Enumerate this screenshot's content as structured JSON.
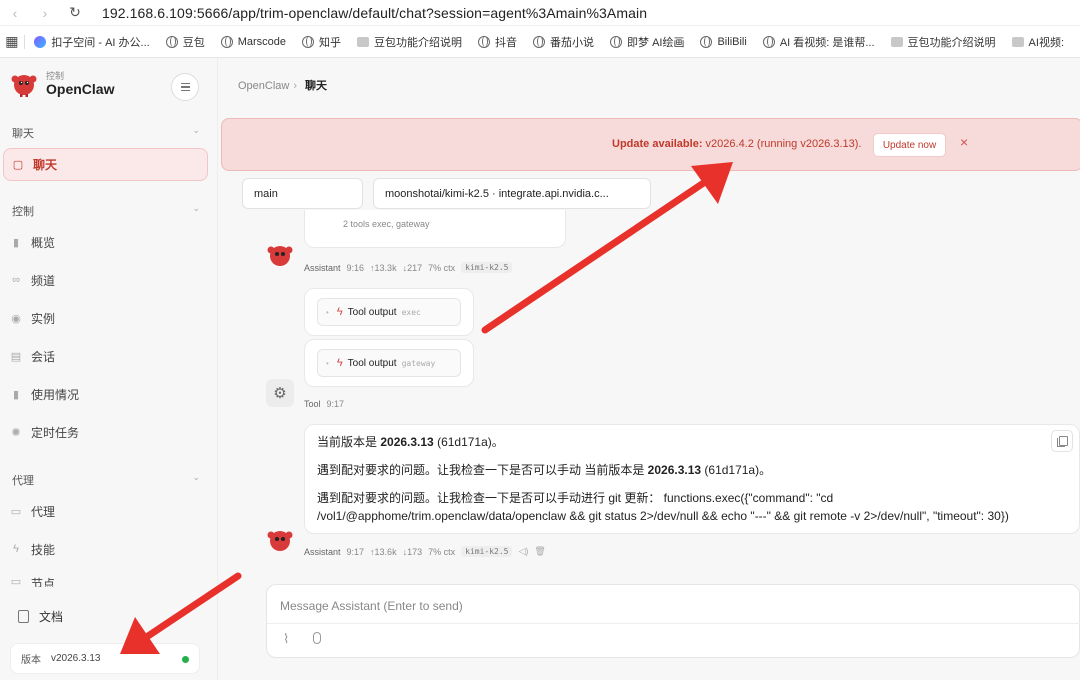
{
  "browser": {
    "url": "192.168.6.109:5666/app/trim-openclaw/default/chat?session=agent%3Amain%3Amain",
    "bookmarks": [
      "扣子空间 - AI 办公...",
      "豆包",
      "Marscode",
      "知乎",
      "豆包功能介绍说明",
      "抖音",
      "番茄小说",
      "即梦 AI绘画",
      "BiliBili",
      "AI 看视频: 是谁帮...",
      "豆包功能介绍说明",
      "AI视频:"
    ]
  },
  "sidebar": {
    "brand_small": "控制",
    "brand_name": "OpenClaw",
    "groups": {
      "chat": "聊天",
      "control": "控制",
      "agent": "代理"
    },
    "items": {
      "chat": "聊天",
      "overview": "概览",
      "channels": "频道",
      "instances": "实例",
      "sessions": "会话",
      "usage": "使用情况",
      "cron": "定时任务",
      "agents": "代理",
      "skills": "技能",
      "nodes": "节点"
    },
    "docs": "文档",
    "version_label": "版本",
    "version_value": "v2026.3.13"
  },
  "header": {
    "crumb_root": "OpenClaw",
    "crumb_sep": "›",
    "crumb_current": "聊天"
  },
  "banner": {
    "bold": "Update available:",
    "text": " v2026.4.2 (running v2026.3.13).",
    "button": "Update now",
    "close": "×"
  },
  "selectors": {
    "session": "main",
    "model": "moonshotai/kimi-k2.5 · integrate.api.nvidia.c..."
  },
  "messages": {
    "partial_tools": "2 tools   exec, gateway",
    "meta1": {
      "name": "Assistant",
      "time": "9:16",
      "up": "↑13.3k",
      "down": "↓217",
      "ctx": "7% ctx",
      "model": "kimi-k2.5"
    },
    "tool_output_1": {
      "label": "Tool output",
      "sub": "exec"
    },
    "tool_output_2": {
      "label": "Tool output",
      "sub": "gateway"
    },
    "tool_meta": {
      "name": "Tool",
      "time": "9:17"
    },
    "reply": {
      "line1_pre": "当前版本是 ",
      "line1_bold": "2026.3.13",
      "line1_post": " (61d171a)。",
      "line2_pre": "遇到配对要求的问题。让我检查一下是否可以手动 当前版本是 ",
      "line2_bold": "2026.3.13",
      "line2_post": " (61d171a)。",
      "line3": "遇到配对要求的问题。让我检查一下是否可以手动进行 git 更新：  functions.exec({\"command\": \"cd",
      "line4": "/vol1/@apphome/trim.openclaw/data/openclaw && git status 2>/dev/null && echo \"---\" && git remote -v 2>/dev/null\", \"timeout\": 30})"
    },
    "meta2": {
      "name": "Assistant",
      "time": "9:17",
      "up": "↑13.6k",
      "down": "↓173",
      "ctx": "7% ctx",
      "model": "kimi-k2.5"
    }
  },
  "composer": {
    "placeholder": "Message Assistant (Enter to send)"
  },
  "colors": {
    "accent": "#c0392b",
    "arrow": "#e8312a",
    "status_green": "#22b04b"
  }
}
